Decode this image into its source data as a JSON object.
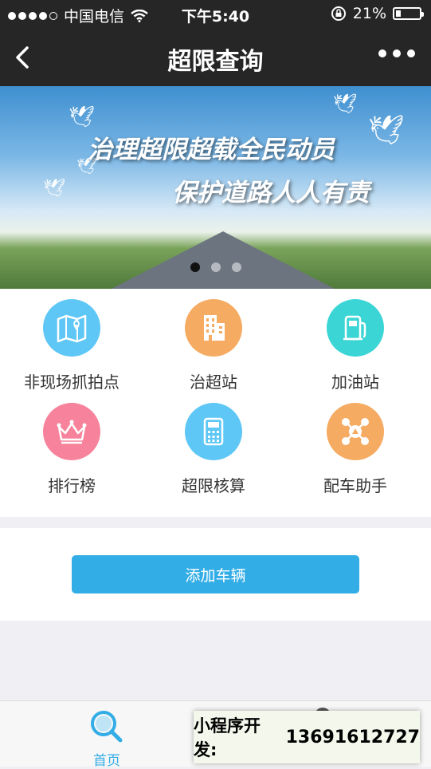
{
  "status_bar": {
    "carrier": "中国电信",
    "time": "下午5:40",
    "battery": "21%",
    "battery_level": 0.21
  },
  "nav": {
    "title": "超限查询"
  },
  "banner": {
    "slogan_line1": "治理超限超载全民动员",
    "slogan_line2": "保护道路人人有责",
    "pages": 3,
    "active_page": 1
  },
  "menu": [
    {
      "label": "非现场抓拍点",
      "icon": "map-pin-icon",
      "color": "#5ec7f6"
    },
    {
      "label": "治超站",
      "icon": "building-icon",
      "color": "#f6ab62"
    },
    {
      "label": "加油站",
      "icon": "fuel-pump-icon",
      "color": "#3bd5d5"
    },
    {
      "label": "排行榜",
      "icon": "crown-icon",
      "color": "#f7829b"
    },
    {
      "label": "超限核算",
      "icon": "calculator-icon",
      "color": "#5ec7f6"
    },
    {
      "label": "配车助手",
      "icon": "network-icon",
      "color": "#f6ab62"
    }
  ],
  "add_vehicle": {
    "label": "添加车辆",
    "color": "#33ade6"
  },
  "tabbar": {
    "home_label": "首页",
    "accent": "#33ade6"
  },
  "promo": {
    "label": "小程序开发:",
    "phone": "13691612727"
  }
}
